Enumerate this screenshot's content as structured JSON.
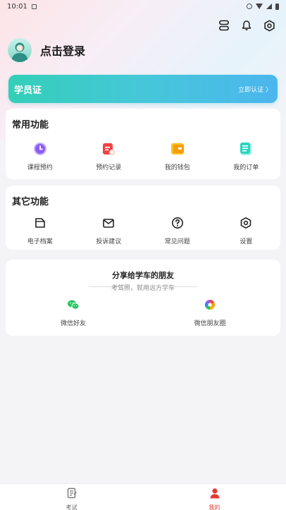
{
  "status_bar": {
    "time": "10:01"
  },
  "profile": {
    "login_text": "点击登录"
  },
  "student_card": {
    "title": "学员证",
    "action": "立即认证"
  },
  "common_functions": {
    "title": "常用功能",
    "items": [
      {
        "label": "课程预约",
        "icon": "clock-icon",
        "color": "#8b5cf6"
      },
      {
        "label": "预约记录",
        "icon": "calendar-record-icon",
        "color": "#ef4444"
      },
      {
        "label": "我的钱包",
        "icon": "wallet-icon",
        "color": "#f59e0b"
      },
      {
        "label": "我的订单",
        "icon": "order-icon",
        "color": "#2dd4bf"
      }
    ]
  },
  "other_functions": {
    "title": "其它功能",
    "items": [
      {
        "label": "电子档案",
        "icon": "folder-icon"
      },
      {
        "label": "投诉建议",
        "icon": "mail-icon"
      },
      {
        "label": "常见问题",
        "icon": "question-icon"
      },
      {
        "label": "设置",
        "icon": "settings-icon"
      }
    ]
  },
  "share": {
    "title": "分享给学车的朋友",
    "subtitle": "考驾照，就用远方学车",
    "items": [
      {
        "label": "微信好友",
        "icon": "wechat-icon",
        "color": "#22c55e"
      },
      {
        "label": "微信朋友圈",
        "icon": "moments-icon"
      }
    ]
  },
  "tabbar": {
    "tabs": [
      {
        "label": "考试",
        "icon": "exam-icon",
        "active": false
      },
      {
        "label": "我的",
        "icon": "person-icon",
        "active": true
      }
    ],
    "active_color": "#e53935"
  }
}
